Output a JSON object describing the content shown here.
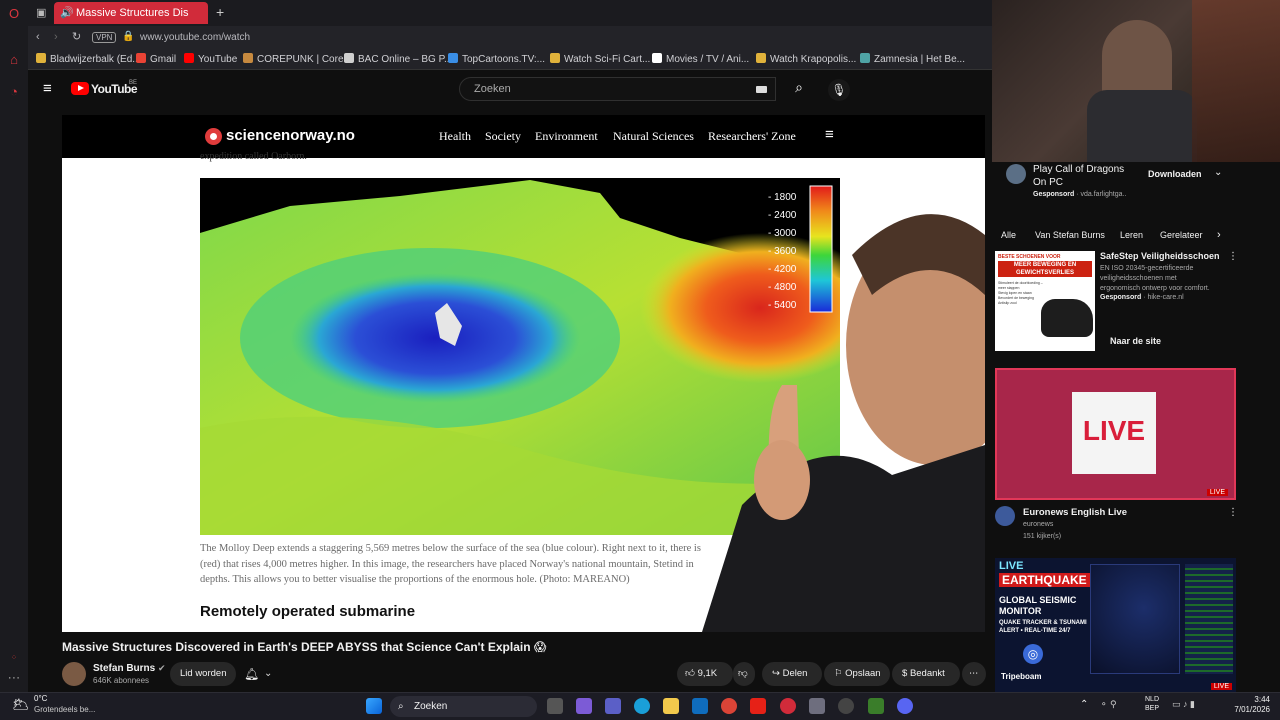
{
  "browser": {
    "tab_title": "Massive Structures Dis",
    "url": "www.youtube.com/watch",
    "vpn_label": "VPN",
    "bookmarks": [
      {
        "label": "Bladwijzerbalk (Ed...",
        "color": "#e0b23b"
      },
      {
        "label": "Gmail",
        "color": "#ea4335"
      },
      {
        "label": "YouTube",
        "color": "#ff0000"
      },
      {
        "label": "COREPUNK | Core...",
        "color": "#c6893f"
      },
      {
        "label": "BAC Online – BG P...",
        "color": "#cfcfcf"
      },
      {
        "label": "TopCartoons.TV:...",
        "color": "#3a8ee6"
      },
      {
        "label": "Watch Sci-Fi Cart...",
        "color": "#e0b23b"
      },
      {
        "label": "Movies / TV / Ani...",
        "color": "#ffffff"
      },
      {
        "label": "Watch Krapopolis...",
        "color": "#e0b23b"
      },
      {
        "label": "Zamnesia | Het Be...",
        "color": "#4fa3a5"
      }
    ]
  },
  "youtube": {
    "logo_text": "YouTube",
    "region": "BE",
    "search_placeholder": "Zoeken"
  },
  "video_frame": {
    "site_logo": "sciencenorway.no",
    "nav": [
      "Health",
      "Society",
      "Environment",
      "Natural Sciences",
      "Researchers' Zone"
    ],
    "partial_text": "expedition called Oarborn.",
    "legend_values": [
      "- 1800",
      "- 2400",
      "- 3000",
      "- 3600",
      "- 4200",
      "- 4800",
      "- 5400"
    ],
    "caption_lines": [
      "The Molloy Deep extends a staggering 5,569 metres below the surface of the sea (blue colour). Right next to it, there is",
      "(red) that rises 4,000 metres higher. In this image, the researchers have placed Norway's national mountain, Stetind in",
      "depths. This allows you to better visualise the proportions of the enormous hole.  (Photo: MAREANO)"
    ],
    "subheading": "Remotely operated submarine"
  },
  "video_info": {
    "title": "Massive Structures Discovered in Earth's DEEP ABYSS that Science Can't Explain 😱",
    "channel_name": "Stefan Burns",
    "subscribers": "646K abonnees",
    "join_label": "Lid worden",
    "likes": "9,1K",
    "share_label": "Delen",
    "save_label": "Opslaan",
    "thanks_label": "Bedankt"
  },
  "sidebar": {
    "sponsored_top": {
      "title_line1": "Play Call of Dragons",
      "title_line2": "On PC",
      "sponsored": "Gesponsord",
      "domain": "· vda.farlightga..",
      "cta": "Downloaden"
    },
    "chips": [
      "Alle",
      "Van Stefan Burns",
      "Leren",
      "Gerelateer"
    ],
    "ad": {
      "title": "SafeStep Veiligheidsschoen",
      "desc1": "EN ISO 20345-gecertificeerde",
      "desc2": "veiligheidsschoenen met",
      "desc3": "ergonomisch ontwerp voor comfort.",
      "sponsored": "Gesponsord",
      "domain": "· hike-care.nl",
      "cta": "Naar de site",
      "banner_line1": "BESTE SCHOENEN VOOR",
      "banner_line2": "MEER BEWEGING EN",
      "banner_line3": "GEWICHTSVERLIES",
      "bullets": [
        "Stimuleert de doorbloeding – meer stappen",
        "Stevig lopen en staan",
        "Bevordert de beweging",
        "Antislip zool"
      ]
    },
    "live1": {
      "thumb_text": "LIVE",
      "badge": "LIVE",
      "title": "Euronews English Live",
      "channel": "euronews",
      "viewers": "151 kijker(s)"
    },
    "live2": {
      "line1": "LIVE",
      "line2": "EARTHQUAKE",
      "line3": "GLOBAL SEISMIC",
      "line4": "MONITOR",
      "line5": "QUAKE TRACKER & TSUNAMI",
      "line6": "ALERT • REAL-TIME 24/7",
      "brand": "Tripeboam",
      "badge": "LIVE"
    }
  },
  "taskbar": {
    "weather_temp": "0°C",
    "weather_desc": "Grotendeels be...",
    "search_label": "Zoeken",
    "lang_line1": "NLD",
    "lang_line2": "BEP",
    "time": "3:44",
    "date": "7/01/2026"
  },
  "colors": {
    "accent_red": "#ff0000",
    "opera_red": "#d12b3a",
    "sciencenorway_red": "#e03c3c"
  }
}
